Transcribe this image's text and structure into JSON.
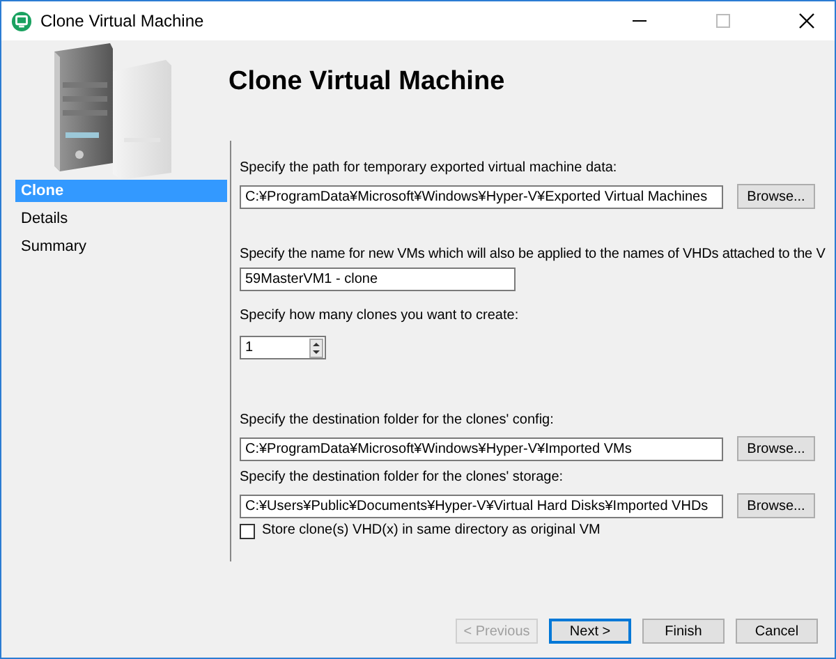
{
  "window": {
    "title": "Clone Virtual Machine",
    "maximize_disabled": true
  },
  "header": "Clone Virtual Machine",
  "sidebar": {
    "items": [
      {
        "label": "Clone",
        "selected": true
      },
      {
        "label": "Details",
        "selected": false
      },
      {
        "label": "Summary",
        "selected": false
      }
    ]
  },
  "sections": [
    {
      "kind": "path",
      "label": "Specify the path for temporary exported virtual machine data:",
      "value": "C:¥ProgramData¥Microsoft¥Windows¥Hyper-V¥Exported Virtual Machines",
      "button": "Browse..."
    },
    {
      "kind": "text",
      "label": "Specify the name for new VMs which will also be applied to the names of VHDs attached to the V",
      "value": "59MasterVM1 - clone"
    },
    {
      "kind": "number",
      "label": "Specify how many clones you want to create:",
      "value": "1"
    },
    {
      "kind": "path",
      "label": "Specify the destination folder for the clones' config:",
      "value": "C:¥ProgramData¥Microsoft¥Windows¥Hyper-V¥Imported VMs",
      "button": "Browse..."
    },
    {
      "kind": "path",
      "label": "Specify the destination folder for the clones' storage:",
      "value": "C:¥Users¥Public¥Documents¥Hyper-V¥Virtual Hard Disks¥Imported VHDs",
      "button": "Browse..."
    },
    {
      "kind": "checkbox",
      "label": "Store clone(s) VHD(x) in same directory as original VM",
      "checked": false
    }
  ],
  "buttons": [
    {
      "label": "< Previous",
      "disabled": true,
      "default": false
    },
    {
      "label": "Next >",
      "disabled": false,
      "default": true
    },
    {
      "label": "Finish",
      "disabled": false,
      "default": false
    },
    {
      "label": "Cancel",
      "disabled": false,
      "default": false
    }
  ]
}
